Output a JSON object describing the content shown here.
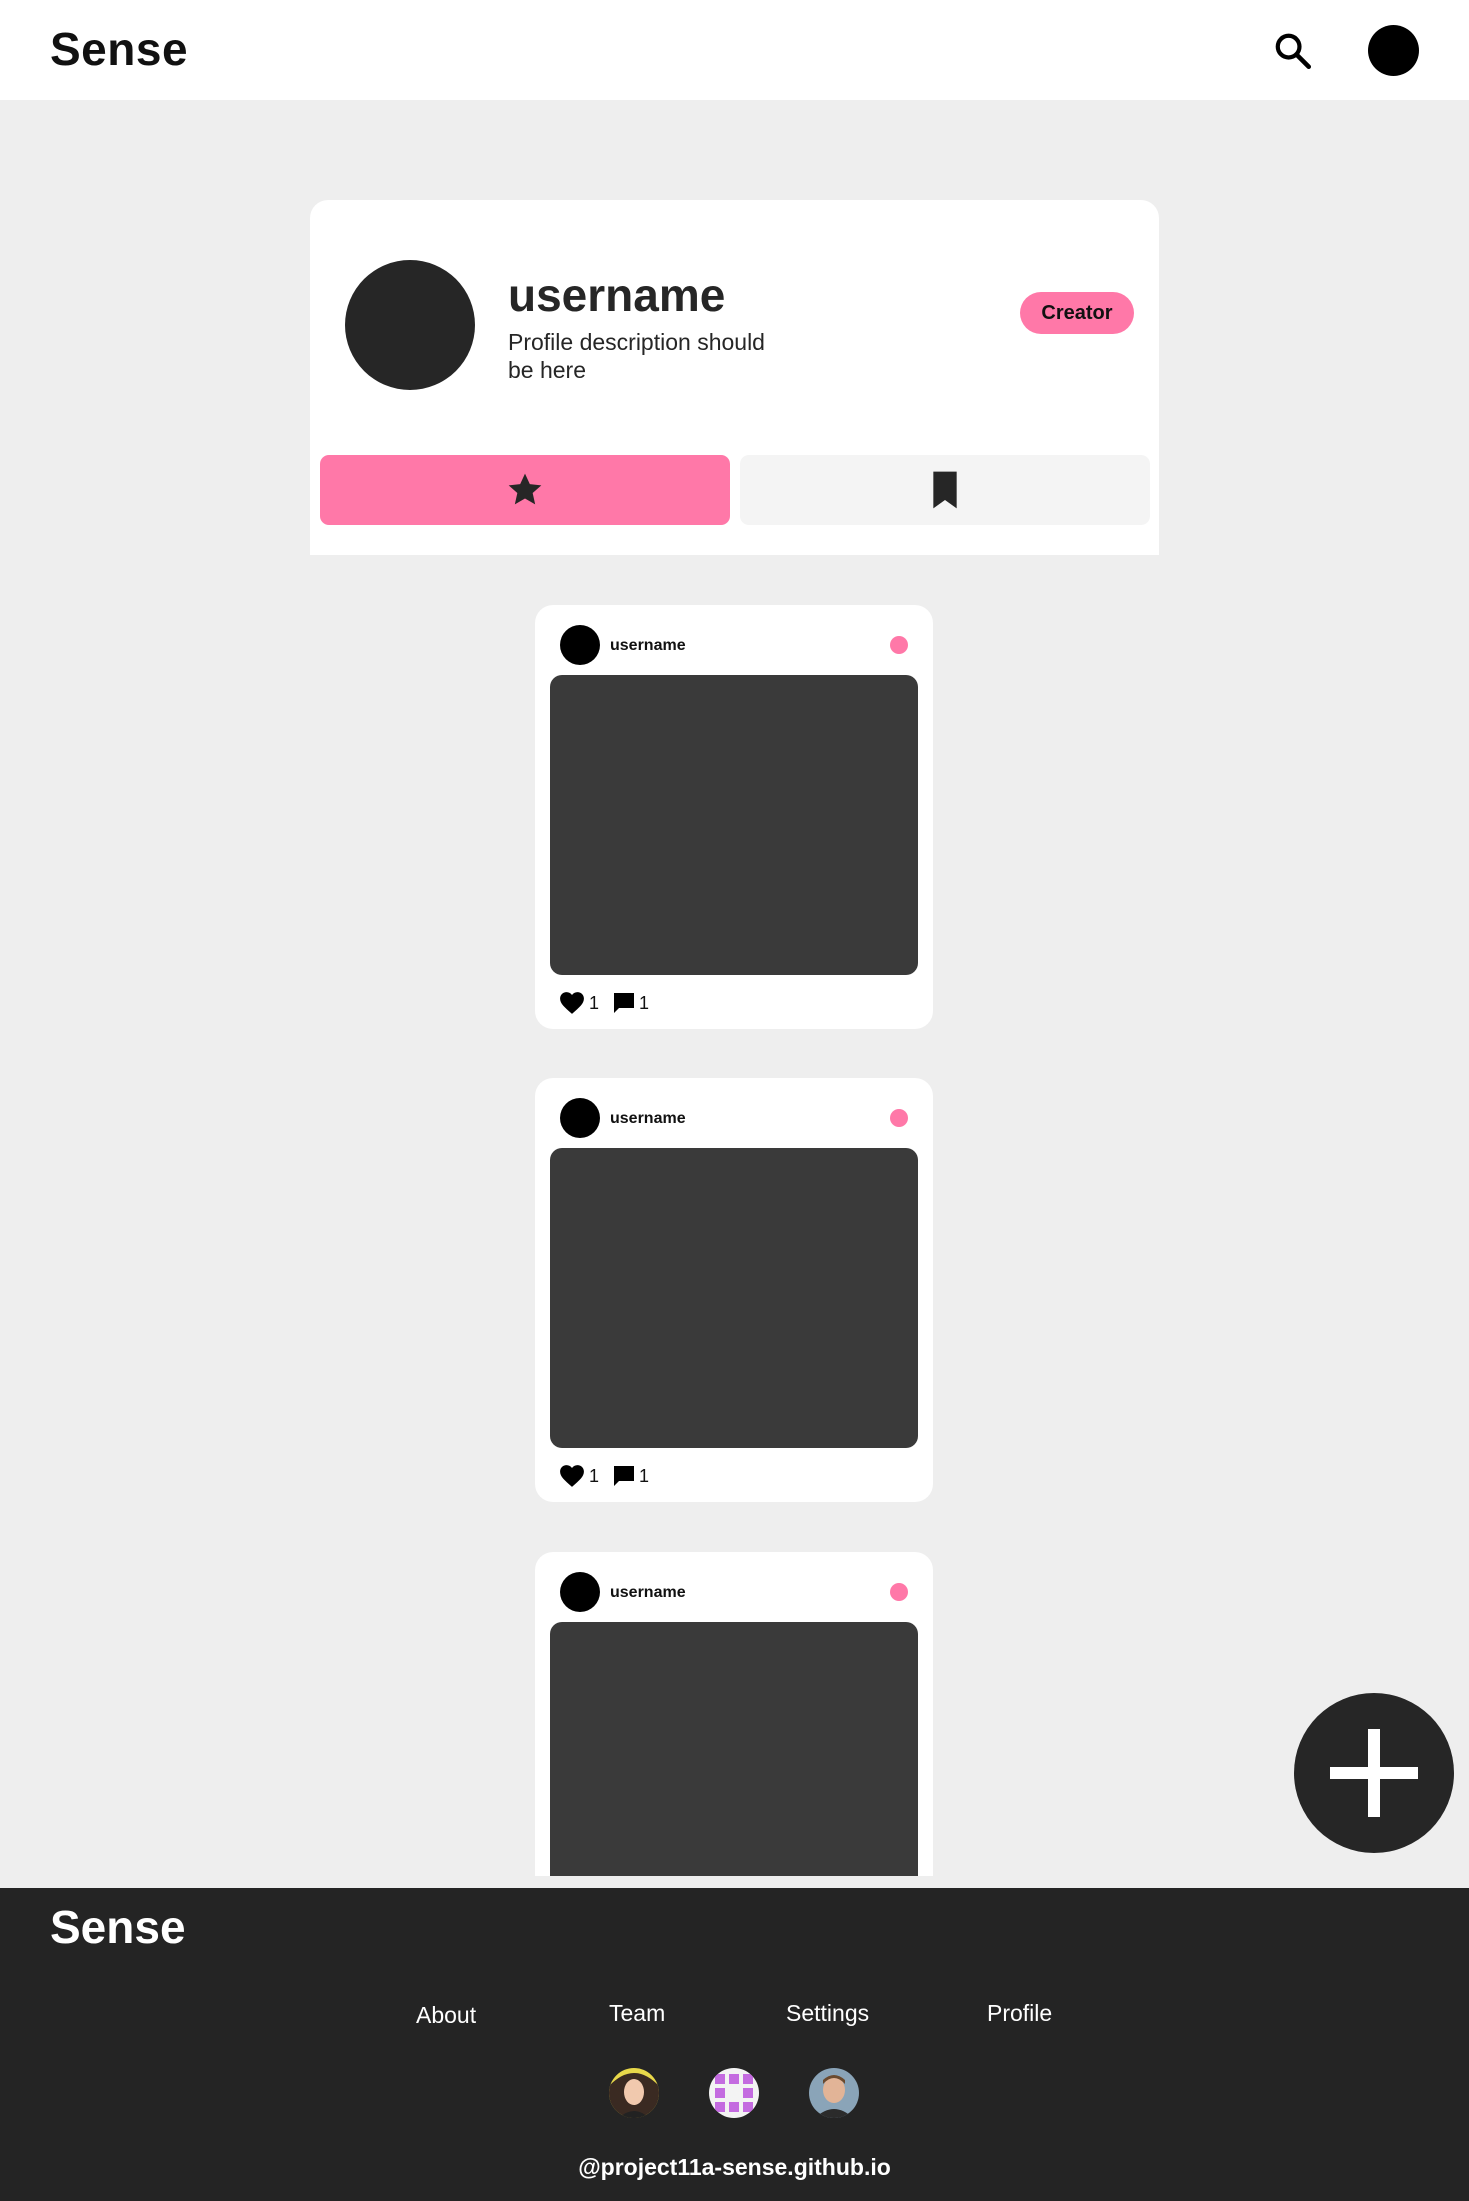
{
  "header": {
    "brand": "Sense",
    "search_icon": "search-icon"
  },
  "profile": {
    "username": "username",
    "description": "Profile description should be here",
    "badge": "Creator",
    "tabs": [
      {
        "icon": "star-icon",
        "active": true
      },
      {
        "icon": "bookmark-icon",
        "active": false
      }
    ]
  },
  "posts": [
    {
      "username": "username",
      "likes": "1",
      "comments": "1"
    },
    {
      "username": "username",
      "likes": "1",
      "comments": "1"
    },
    {
      "username": "username"
    }
  ],
  "fab": {
    "icon": "plus-icon"
  },
  "footer": {
    "brand": "Sense",
    "links": [
      "About",
      "Team",
      "Settings",
      "Profile"
    ],
    "credit": "@project11a-sense.github.io"
  },
  "colors": {
    "accent": "#ff78a8",
    "dark": "#262626",
    "background": "#eeeeee",
    "footer": "#242424"
  }
}
